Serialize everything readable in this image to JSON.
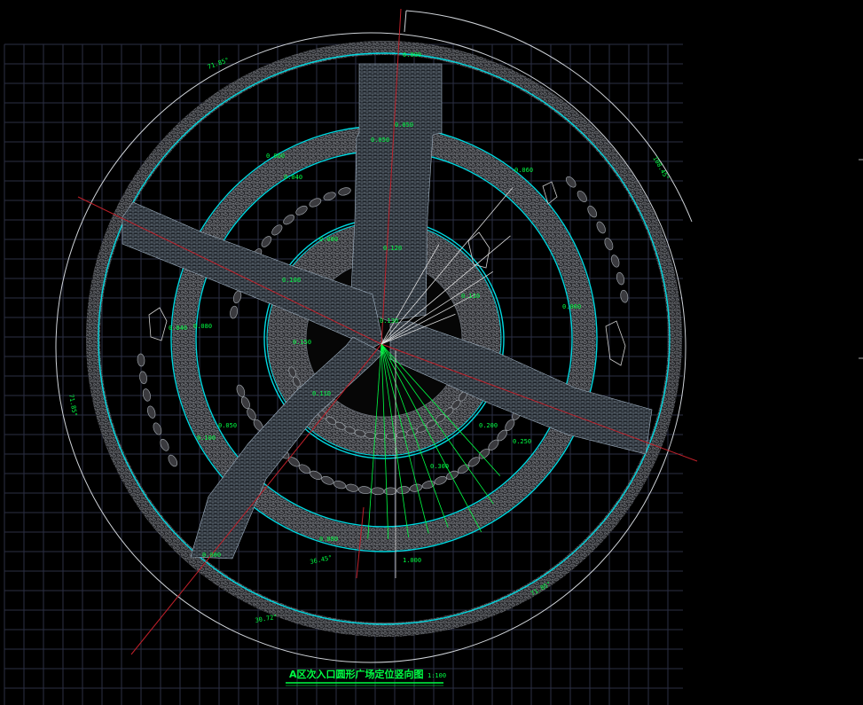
{
  "title": "A区次入口圆形广场定位竖向图",
  "scale": "1:100",
  "angle_labels": [
    "71.85°",
    "108.45°",
    "71.85°",
    "30.72°",
    "36.45°",
    "71.85°"
  ],
  "spot_elevations": [
    "0.000",
    "0.050",
    "0.050",
    "0.060",
    "0.040",
    "0.060",
    "0.080",
    "0.100",
    "0.110",
    "0.120",
    "0.130",
    "0.150",
    "0.200",
    "0.250",
    "0.300",
    "1.000",
    "0.080",
    "0.040",
    "0.060",
    "0.110",
    "0.100",
    "0.050",
    "0.080",
    "0.000"
  ],
  "colors": {
    "background": "#000000",
    "grid": "#2b2f44",
    "ring_cyan": "#00d8e0",
    "outline_white": "#cfd3d8",
    "axis_red": "#c0202a",
    "text_green": "#00ff44"
  }
}
